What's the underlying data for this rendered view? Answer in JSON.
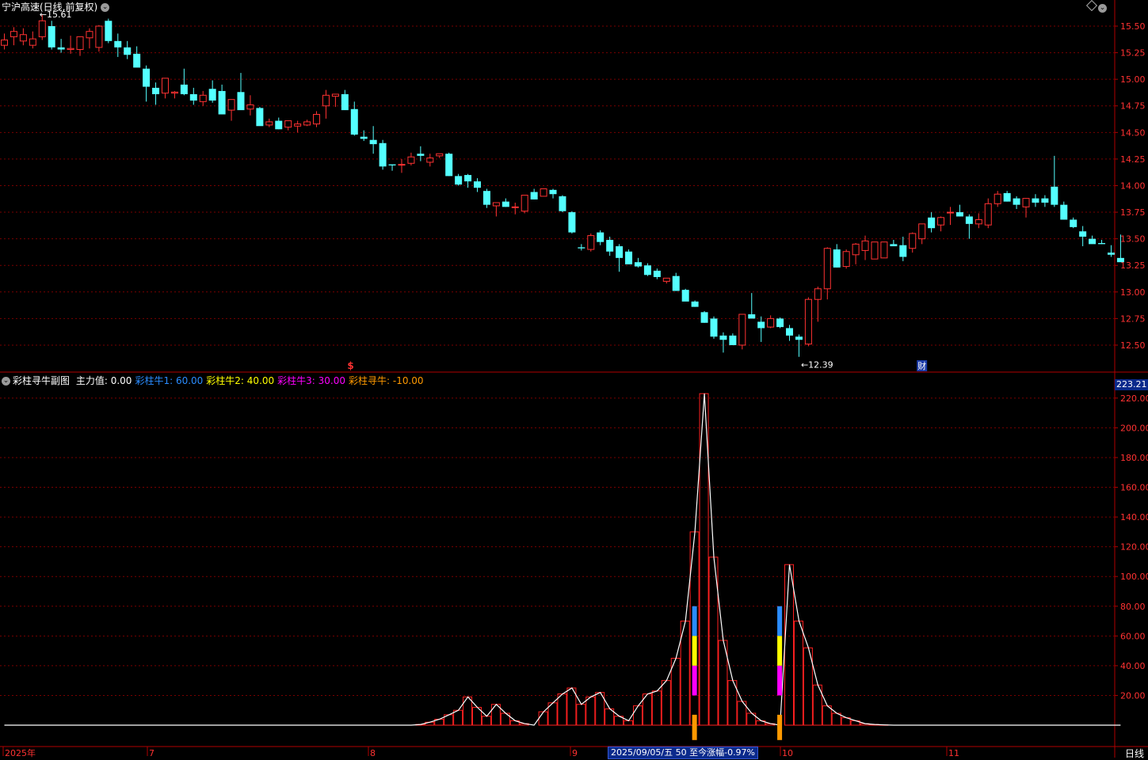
{
  "window": {
    "title": "宁沪高速(日线,前复权)",
    "period_label": "日线"
  },
  "colors": {
    "up": "#ff3232",
    "down": "#54ffff",
    "grid": "#7a0000",
    "axis": "#b00000",
    "text_dim": "#c0c0c0",
    "main_line": "#ffffff",
    "caizhu1": "#2a8cff",
    "caizhu2": "#ffff00",
    "caizhu3": "#ff00ff",
    "xunniu": "#ff9900"
  },
  "icons": {
    "collapse": "chevron-down-icon",
    "settings": "diamond-icon",
    "signal": "dollar-sign-icon",
    "finance": "finance-badge-icon"
  },
  "markers": {
    "high_label": "15.61",
    "low_label": "12.39",
    "signal_symbol": "$",
    "finance_symbol": "财"
  },
  "indicator": {
    "name": "彩柱寻牛副图",
    "items": [
      {
        "label": "主力值:",
        "value": "0.00",
        "color": "#ffffff"
      },
      {
        "label": "彩柱牛1:",
        "value": "60.00",
        "color": "#2a8cff"
      },
      {
        "label": "彩柱牛2:",
        "value": "40.00",
        "color": "#ffff00"
      },
      {
        "label": "彩柱牛3:",
        "value": "30.00",
        "color": "#ff00ff"
      },
      {
        "label": "彩柱寻牛:",
        "value": "-10.00",
        "color": "#ff9900"
      }
    ],
    "ymax_label": "223.21"
  },
  "status_bar": {
    "text": "2025/09/05/五 50 至今涨幅-0.97%"
  },
  "chart_data": [
    {
      "type": "candlestick",
      "title": "宁沪高速(日线,前复权)",
      "y_ticks": [
        "15.50",
        "15.25",
        "15.00",
        "14.75",
        "14.50",
        "14.25",
        "14.00",
        "13.75",
        "13.50",
        "13.25",
        "13.00",
        "12.75",
        "12.50"
      ],
      "x_labels": [
        "2025年",
        "7",
        "8",
        "9",
        "10",
        "11"
      ],
      "ylim": [
        12.38,
        15.62
      ],
      "annotations": {
        "high": 15.61,
        "low": 12.39
      },
      "ohlc": [
        [
          15.32,
          15.43,
          15.28,
          15.37
        ],
        [
          15.4,
          15.49,
          15.32,
          15.45
        ],
        [
          15.36,
          15.48,
          15.32,
          15.42
        ],
        [
          15.32,
          15.45,
          15.29,
          15.38
        ],
        [
          15.4,
          15.61,
          15.37,
          15.55
        ],
        [
          15.5,
          15.55,
          15.28,
          15.3
        ],
        [
          15.3,
          15.38,
          15.25,
          15.28
        ],
        [
          15.28,
          15.41,
          15.24,
          15.29
        ],
        [
          15.28,
          15.38,
          15.22,
          15.4
        ],
        [
          15.39,
          15.48,
          15.29,
          15.45
        ],
        [
          15.3,
          15.51,
          15.26,
          15.5
        ],
        [
          15.55,
          15.57,
          15.34,
          15.36
        ],
        [
          15.36,
          15.43,
          15.21,
          15.3
        ],
        [
          15.3,
          15.36,
          15.19,
          15.23
        ],
        [
          15.24,
          15.31,
          15.14,
          15.11
        ],
        [
          15.1,
          15.13,
          14.79,
          14.93
        ],
        [
          14.92,
          14.97,
          14.76,
          14.86
        ],
        [
          14.87,
          14.99,
          14.82,
          15.01
        ],
        [
          14.87,
          14.89,
          14.82,
          14.88
        ],
        [
          14.95,
          15.1,
          14.85,
          14.86
        ],
        [
          14.86,
          14.92,
          14.76,
          14.8
        ],
        [
          14.79,
          14.89,
          14.75,
          14.85
        ],
        [
          14.91,
          14.99,
          14.78,
          14.8
        ],
        [
          14.89,
          14.95,
          14.67,
          14.67
        ],
        [
          14.71,
          14.8,
          14.61,
          14.81
        ],
        [
          14.88,
          15.06,
          14.78,
          14.71
        ],
        [
          14.72,
          14.85,
          14.66,
          14.76
        ],
        [
          14.73,
          14.74,
          14.61,
          14.56
        ],
        [
          14.57,
          14.63,
          14.55,
          14.6
        ],
        [
          14.61,
          14.64,
          14.53,
          14.53
        ],
        [
          14.55,
          14.61,
          14.52,
          14.61
        ],
        [
          14.56,
          14.61,
          14.5,
          14.58
        ],
        [
          14.57,
          14.62,
          14.56,
          14.6
        ],
        [
          14.58,
          14.7,
          14.55,
          14.67
        ],
        [
          14.75,
          14.9,
          14.63,
          14.85
        ],
        [
          14.84,
          14.85,
          14.74,
          14.86
        ],
        [
          14.86,
          14.9,
          14.75,
          14.71
        ],
        [
          14.72,
          14.79,
          14.47,
          14.48
        ],
        [
          14.46,
          14.52,
          14.42,
          14.44
        ],
        [
          14.43,
          14.56,
          14.3,
          14.39
        ],
        [
          14.4,
          14.43,
          14.15,
          14.18
        ],
        [
          14.2,
          14.2,
          14.14,
          14.19
        ],
        [
          14.2,
          14.25,
          14.12,
          14.2
        ],
        [
          14.21,
          14.31,
          14.19,
          14.27
        ],
        [
          14.3,
          14.37,
          14.23,
          14.28
        ],
        [
          14.22,
          14.3,
          14.18,
          14.26
        ],
        [
          14.28,
          14.29,
          14.26,
          14.3
        ],
        [
          14.3,
          14.31,
          14.09,
          14.09
        ],
        [
          14.09,
          14.11,
          14.0,
          14.01
        ],
        [
          14.1,
          14.11,
          13.98,
          14.04
        ],
        [
          14.04,
          14.07,
          13.94,
          13.98
        ],
        [
          13.95,
          13.97,
          13.79,
          13.82
        ],
        [
          13.81,
          13.83,
          13.71,
          13.84
        ],
        [
          13.85,
          13.88,
          13.8,
          13.8
        ],
        [
          13.8,
          13.84,
          13.73,
          13.8
        ],
        [
          13.76,
          13.9,
          13.74,
          13.91
        ],
        [
          13.94,
          13.97,
          13.87,
          13.87
        ],
        [
          13.9,
          13.96,
          13.9,
          13.97
        ],
        [
          13.96,
          13.97,
          13.88,
          13.92
        ],
        [
          13.9,
          13.91,
          13.75,
          13.76
        ],
        [
          13.75,
          13.76,
          13.55,
          13.56
        ],
        [
          13.42,
          13.45,
          13.39,
          13.41
        ],
        [
          13.4,
          13.55,
          13.38,
          13.53
        ],
        [
          13.56,
          13.58,
          13.44,
          13.47
        ],
        [
          13.49,
          13.52,
          13.34,
          13.38
        ],
        [
          13.43,
          13.45,
          13.19,
          13.32
        ],
        [
          13.38,
          13.4,
          13.28,
          13.26
        ],
        [
          13.28,
          13.32,
          13.23,
          13.24
        ],
        [
          13.25,
          13.27,
          13.15,
          13.16
        ],
        [
          13.2,
          13.22,
          13.12,
          13.14
        ],
        [
          13.1,
          13.12,
          13.08,
          13.13
        ],
        [
          13.15,
          13.18,
          13.01,
          13.01
        ],
        [
          13.02,
          13.03,
          12.97,
          12.91
        ],
        [
          12.91,
          12.92,
          12.86,
          12.86
        ],
        [
          12.81,
          12.82,
          12.71,
          12.71
        ],
        [
          12.75,
          12.77,
          12.56,
          12.58
        ],
        [
          12.59,
          12.62,
          12.43,
          12.55
        ],
        [
          12.59,
          12.61,
          12.52,
          12.5
        ],
        [
          12.5,
          12.78,
          12.46,
          12.79
        ],
        [
          12.79,
          12.99,
          12.75,
          12.75
        ],
        [
          12.72,
          12.77,
          12.53,
          12.66
        ],
        [
          12.67,
          12.78,
          12.66,
          12.75
        ],
        [
          12.75,
          12.76,
          12.66,
          12.67
        ],
        [
          12.66,
          12.69,
          12.54,
          12.59
        ],
        [
          12.58,
          12.6,
          12.39,
          12.55
        ],
        [
          12.51,
          12.95,
          12.49,
          12.93
        ],
        [
          12.93,
          13.05,
          12.72,
          13.03
        ],
        [
          13.03,
          13.42,
          12.93,
          13.41
        ],
        [
          13.4,
          13.45,
          13.23,
          13.23
        ],
        [
          13.24,
          13.4,
          13.22,
          13.38
        ],
        [
          13.35,
          13.46,
          13.26,
          13.45
        ],
        [
          13.39,
          13.53,
          13.3,
          13.48
        ],
        [
          13.31,
          13.47,
          13.31,
          13.47
        ],
        [
          13.32,
          13.47,
          13.32,
          13.47
        ],
        [
          13.45,
          13.49,
          13.44,
          13.43
        ],
        [
          13.44,
          13.52,
          13.29,
          13.33
        ],
        [
          13.41,
          13.56,
          13.37,
          13.55
        ],
        [
          13.5,
          13.6,
          13.45,
          13.64
        ],
        [
          13.7,
          13.75,
          13.56,
          13.6
        ],
        [
          13.63,
          13.71,
          13.57,
          13.7
        ],
        [
          13.75,
          13.8,
          13.63,
          13.75
        ],
        [
          13.75,
          13.82,
          13.71,
          13.71
        ],
        [
          13.71,
          13.73,
          13.5,
          13.64
        ],
        [
          13.64,
          13.74,
          13.6,
          13.68
        ],
        [
          13.63,
          13.88,
          13.6,
          13.83
        ],
        [
          13.83,
          13.95,
          13.8,
          13.92
        ],
        [
          13.93,
          13.95,
          13.85,
          13.85
        ],
        [
          13.88,
          13.9,
          13.78,
          13.82
        ],
        [
          13.8,
          13.88,
          13.7,
          13.88
        ],
        [
          13.88,
          13.92,
          13.8,
          13.84
        ],
        [
          13.88,
          13.91,
          13.8,
          13.84
        ],
        [
          13.99,
          14.28,
          13.8,
          13.82
        ],
        [
          13.82,
          13.85,
          13.68,
          13.68
        ],
        [
          13.68,
          13.7,
          13.6,
          13.61
        ],
        [
          13.57,
          13.62,
          13.43,
          13.52
        ],
        [
          13.5,
          13.53,
          13.46,
          13.45
        ],
        [
          13.46,
          13.49,
          13.45,
          13.45
        ],
        [
          13.37,
          13.44,
          13.33,
          13.35
        ],
        [
          13.32,
          13.54,
          13.29,
          13.28
        ]
      ]
    },
    {
      "type": "bar",
      "title": "彩柱寻牛副图",
      "y_ticks": [
        "220.00",
        "200.00",
        "180.00",
        "160.00",
        "140.00",
        "120.00",
        "100.00",
        "80.00",
        "60.00",
        "40.00",
        "20.00"
      ],
      "x_labels": [
        "2025年",
        "7",
        "8",
        "9",
        "10",
        "11"
      ],
      "ylim": [
        -15,
        223.21
      ],
      "series": [
        {
          "name": "主力值",
          "values": [
            0,
            0,
            0,
            0,
            0,
            0,
            0,
            0,
            0,
            0,
            0,
            0,
            0,
            0,
            0,
            0,
            0,
            0,
            0,
            0,
            0,
            0,
            0,
            0,
            0,
            0,
            0,
            0,
            0,
            0,
            0,
            0,
            0,
            0,
            0,
            0,
            0,
            0,
            0,
            0,
            0,
            0,
            0,
            0,
            0.5,
            2,
            4,
            7,
            10,
            19,
            12,
            6,
            14,
            8,
            3,
            1,
            0,
            9,
            15,
            21,
            25,
            14,
            19,
            22,
            11,
            6,
            3,
            13,
            21,
            23,
            30,
            45,
            70,
            130,
            223,
            113,
            57,
            30,
            16,
            8,
            3,
            1,
            0,
            108,
            70,
            52,
            27,
            13,
            8,
            5,
            3,
            1,
            0.5,
            0.2,
            0,
            0,
            0,
            0,
            0,
            0,
            0,
            0,
            0,
            0,
            0,
            0,
            0,
            0,
            0,
            0,
            0,
            0,
            0,
            0,
            0,
            0,
            0,
            0,
            0
          ]
        },
        {
          "name": "彩柱牛1",
          "signal_days": [
            73,
            82
          ],
          "segment": [
            60,
            80
          ]
        },
        {
          "name": "彩柱牛2",
          "signal_days": [
            73,
            82
          ],
          "segment": [
            40,
            60
          ]
        },
        {
          "name": "彩柱牛3",
          "signal_days": [
            73,
            82
          ],
          "segment": [
            20,
            40
          ]
        },
        {
          "name": "彩柱寻牛",
          "signal_days": [
            73,
            82
          ],
          "segment": [
            -10,
            7
          ]
        }
      ]
    }
  ]
}
